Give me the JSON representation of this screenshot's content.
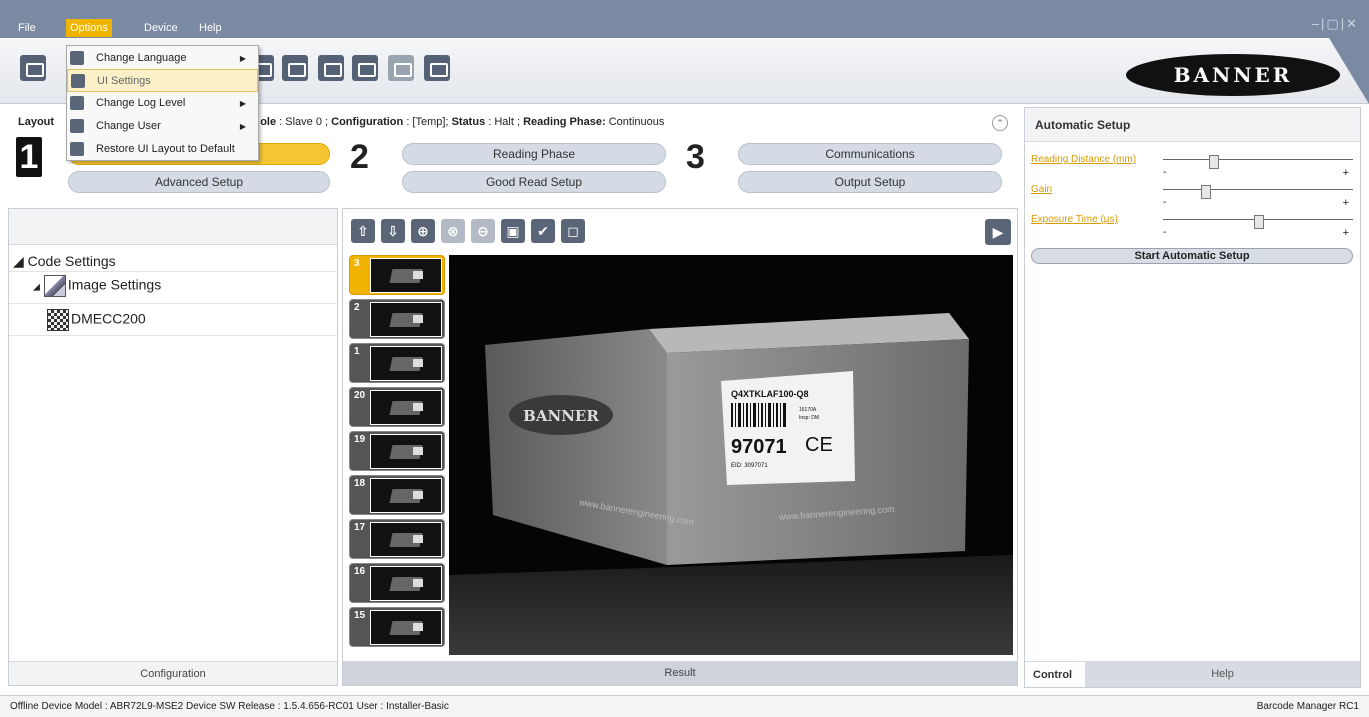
{
  "menubar": {
    "items": [
      "File",
      "Options",
      "Device",
      "Help"
    ],
    "active": "Options",
    "window_controls": "–|▢|✕"
  },
  "toolbar": {
    "logo_text": "BANNER"
  },
  "options_menu": {
    "items": [
      {
        "label": "Change Language",
        "submenu": true
      },
      {
        "label": "UI Settings",
        "submenu": false
      },
      {
        "label": "Change Log Level",
        "submenu": true
      },
      {
        "label": "Change User",
        "submenu": true
      },
      {
        "label": "Restore UI Layout to Default",
        "submenu": false
      }
    ],
    "highlighted": "UI Settings",
    "submenu_arrow": "▶"
  },
  "info": {
    "layout_label": "Layout",
    "role_label": "ole",
    "role_value": ": Slave 0 ;",
    "configuration_label": "Configuration",
    "configuration_value": ": [Temp];",
    "status_label": "Status",
    "status_value": ": Halt ;",
    "reading_phase_label": "Reading Phase:",
    "reading_phase_value": "Continuous",
    "collapse_icon": "⌃"
  },
  "steps": {
    "one": "1",
    "two": "2",
    "three": "3",
    "buttons": {
      "advanced_setup": "Advanced Setup",
      "reading_phase": "Reading Phase",
      "good_read_setup": "Good Read Setup",
      "communications": "Communications",
      "output_setup": "Output Setup"
    }
  },
  "tree": {
    "root": "◢ Code Settings",
    "child": "Image Settings",
    "child_arrow": "◢",
    "leaf": "DMECC200"
  },
  "left_footer": "Configuration",
  "view_tools": [
    "⇧",
    "⇩",
    "⊕",
    "⊗",
    "⊖",
    "▣",
    "✔",
    "◻"
  ],
  "play_icon": "▶",
  "thumbnails": [
    "3",
    "2",
    "1",
    "20",
    "19",
    "18",
    "17",
    "16",
    "15"
  ],
  "image_view": {
    "label_code": "Q4XTKLAF100-Q8",
    "label_small": "16170A",
    "label_small2": "Insp: DM",
    "label_number": "97071",
    "label_eid": "EID: 3097071",
    "ce_mark": "CE",
    "box_logo": "BANNER",
    "url_text": "www.bannerengineering.com"
  },
  "result_label": "Result",
  "right_panel": {
    "title": "Automatic Setup",
    "params": [
      {
        "label": "Reading Distance (mm)",
        "min": "-",
        "max": "+",
        "level": 0.24
      },
      {
        "label": "Gain",
        "min": "-",
        "max": "+",
        "level": 0.2
      },
      {
        "label": "Exposure Time (µs)",
        "min": "-",
        "max": "+",
        "level": 0.48
      }
    ],
    "start_button": "Start Automatic Setup",
    "tabs": {
      "control": "Control",
      "help": "Help"
    }
  },
  "statusbar": {
    "left": "Offline Device  Model : ABR72L9-MSE2   Device SW Release : 1.5.4.656-RC01   User : Installer-Basic",
    "right": "Barcode Manager RC1"
  },
  "colors": {
    "accent": "#f0b400",
    "menubar": "#7a8aa3",
    "brand_orange": "#d69b00"
  }
}
